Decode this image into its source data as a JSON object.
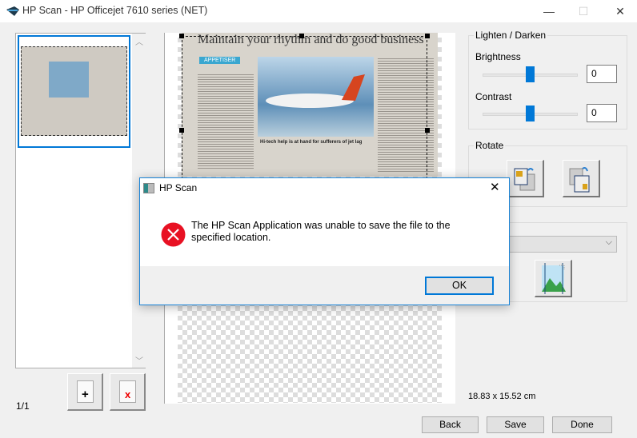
{
  "window": {
    "title": "HP Scan - HP Officejet 7610 series (NET)",
    "minimize": "—",
    "maximize": "☐",
    "close": "✕"
  },
  "thumbnails": {
    "page_counter": "1/1",
    "add_page_label": "+",
    "delete_page_label": "x"
  },
  "preview": {
    "headline": "Maintain your rhythm and do good business",
    "section": "APPETISER",
    "caption": "Hi-tech help is at hand for sufferers of jet lag"
  },
  "adjust": {
    "group_label": "Lighten / Darken",
    "brightness_label": "Brightness",
    "brightness_value": "0",
    "brightness_level": 0.5,
    "contrast_label": "Contrast",
    "contrast_value": "0",
    "contrast_level": 0.5
  },
  "rotate": {
    "group_label": "Rotate"
  },
  "size_readout": "18.83 x 15.52 cm",
  "buttons": {
    "back": "Back",
    "save": "Save",
    "done": "Done"
  },
  "dialog": {
    "title": "HP Scan",
    "message": "The HP Scan Application was unable to save the file to the specified location.",
    "ok": "OK",
    "close": "✕"
  },
  "colors": {
    "accent": "#0078d7",
    "error": "#e81123"
  }
}
